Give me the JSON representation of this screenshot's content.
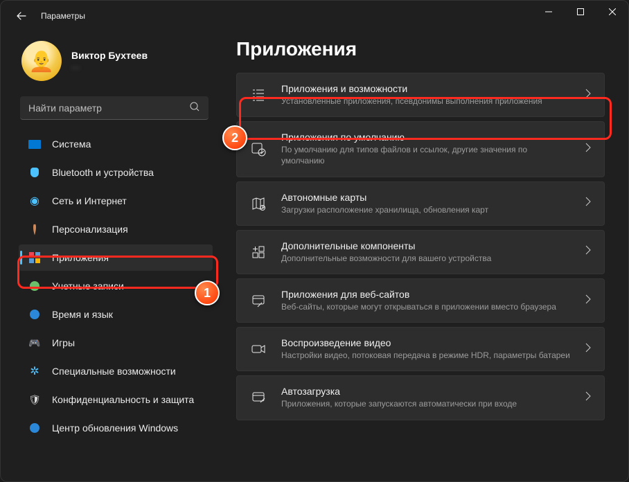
{
  "titlebar": {
    "label": "Параметры"
  },
  "profile": {
    "name": "Виктор Бухтеев",
    "sub": "—"
  },
  "search": {
    "placeholder": "Найти параметр"
  },
  "sidebar": {
    "items": [
      {
        "label": "Система"
      },
      {
        "label": "Bluetooth и устройства"
      },
      {
        "label": "Сеть и Интернет"
      },
      {
        "label": "Персонализация"
      },
      {
        "label": "Приложения"
      },
      {
        "label": "Учетные записи"
      },
      {
        "label": "Время и язык"
      },
      {
        "label": "Игры"
      },
      {
        "label": "Специальные возможности"
      },
      {
        "label": "Конфиденциальность и защита"
      },
      {
        "label": "Центр обновления Windows"
      }
    ]
  },
  "main": {
    "title": "Приложения",
    "cards": [
      {
        "title": "Приложения и возможности",
        "sub": "Установленные приложения, псевдонимы выполнения приложения"
      },
      {
        "title": "Приложения по умолчанию",
        "sub": "По умолчанию для типов файлов и ссылок, другие значения по умолчанию"
      },
      {
        "title": "Автономные карты",
        "sub": "Загрузки расположение хранилища, обновления карт"
      },
      {
        "title": "Дополнительные компоненты",
        "sub": "Дополнительные возможности для вашего устройства"
      },
      {
        "title": "Приложения для веб-сайтов",
        "sub": "Веб-сайты, которые могут открываться в приложении вместо браузера"
      },
      {
        "title": "Воспроизведение видео",
        "sub": "Настройки видео, потоковая передача в режиме HDR, параметры батареи"
      },
      {
        "title": "Автозагрузка",
        "sub": "Приложения, которые запускаются автоматически при входе"
      }
    ]
  },
  "annotations": {
    "step1": "1",
    "step2": "2"
  }
}
